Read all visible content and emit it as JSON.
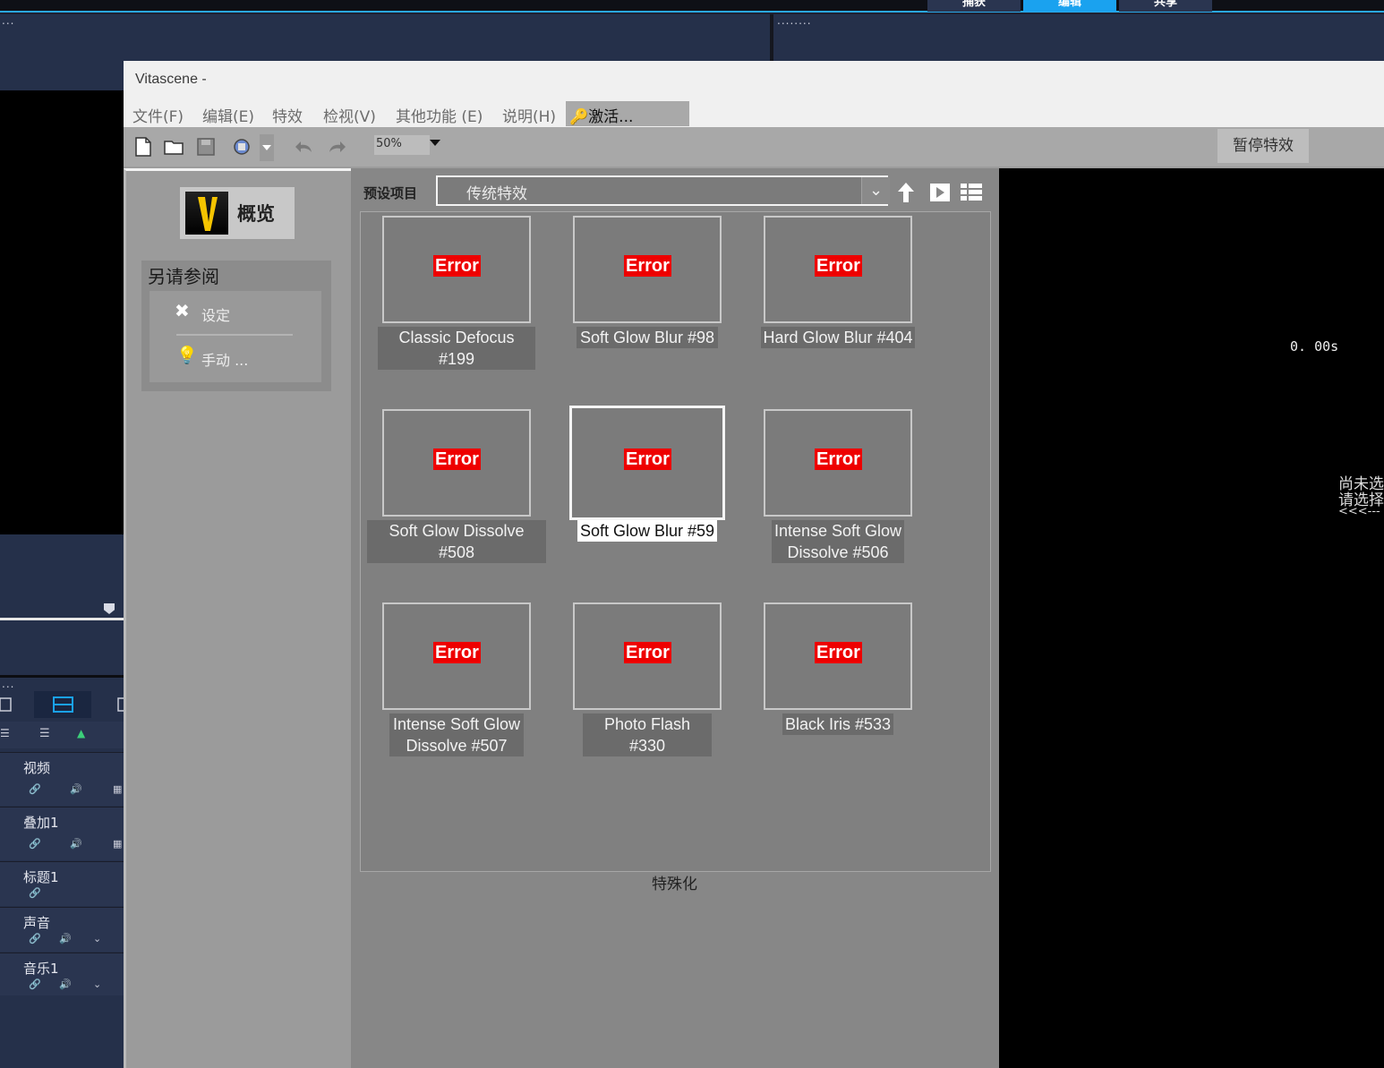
{
  "host": {
    "tabs": [
      "捕获",
      "编辑",
      "共享"
    ],
    "active_tab": "编辑",
    "dots_left": "...",
    "dots_right": "........",
    "dots_tracks": "...",
    "tracks": [
      {
        "label": "视频"
      },
      {
        "label": "叠加1"
      },
      {
        "label": "标题1"
      },
      {
        "label": "声音"
      },
      {
        "label": "音乐1"
      }
    ]
  },
  "window": {
    "title": "Vitascene -",
    "menu": [
      "文件(F)",
      "编辑(E)",
      "特效",
      "检视(V)",
      "其他功能 (E)",
      "说明(H)"
    ],
    "activate": "激活...",
    "zoom": "50%",
    "pause_label": "暂停特效"
  },
  "left_panel": {
    "overview_label": "概览",
    "see_also_title": "另请参阅",
    "items": [
      "设定",
      "手动 ..."
    ]
  },
  "center": {
    "preset_label": "预设项目",
    "preset_value": "传统特效",
    "special_label": "特殊化",
    "error_text": "Error",
    "presets": [
      {
        "name": "Classic Defocus #199",
        "selected": false
      },
      {
        "name": "Soft Glow Blur #98",
        "selected": false
      },
      {
        "name": "Hard Glow Blur #404",
        "selected": false
      },
      {
        "name": "Soft Glow Dissolve #508",
        "selected": false
      },
      {
        "name": "Soft Glow Blur #59",
        "selected": true
      },
      {
        "name": "Intense Soft Glow Dissolve #506",
        "selected": false
      },
      {
        "name": "Intense Soft Glow Dissolve #507",
        "selected": false
      },
      {
        "name": "Photo Flash #330",
        "selected": false
      },
      {
        "name": "Black Iris #533",
        "selected": false
      }
    ]
  },
  "preview": {
    "time": "0. 00s",
    "status_line1": "尚未选",
    "status_line2": "请选择",
    "status_line3": "<<<---"
  },
  "colors": {
    "accent": "#1aa2ef",
    "error_bg": "#ee0000",
    "window_bg": "#888888"
  }
}
